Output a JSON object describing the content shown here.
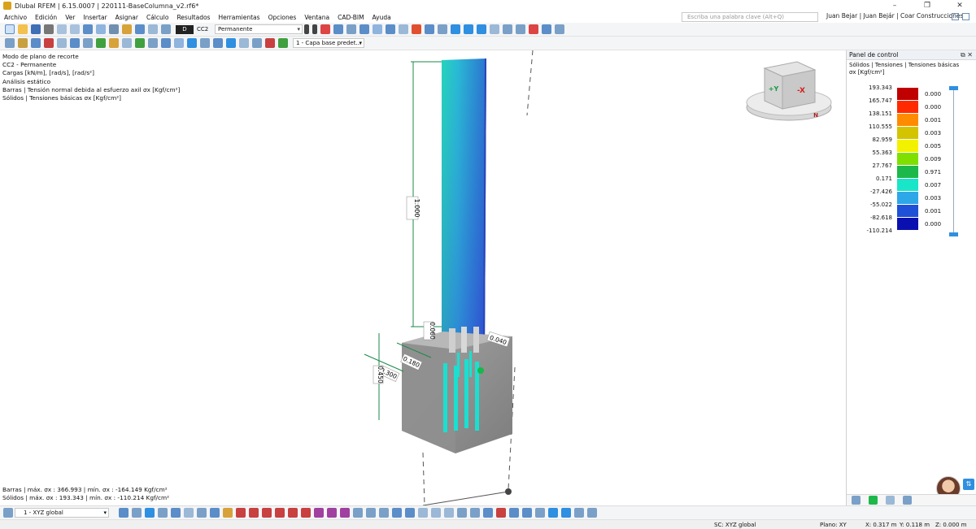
{
  "window": {
    "title": "Dlubal RFEM | 6.15.0007 | 220111-BaseColumna_v2.rf6*",
    "controls": [
      "–",
      "❐",
      "✕"
    ]
  },
  "menu": {
    "items": [
      "Archivo",
      "Edición",
      "Ver",
      "Insertar",
      "Asignar",
      "Cálculo",
      "Resultados",
      "Herramientas",
      "Opciones",
      "Ventana",
      "CAD-BIM",
      "Ayuda"
    ],
    "search_placeholder": "Escriba una palabra clave (Alt+Q)",
    "user": "Juan Bejar | Juan Bejár | Coar Construcciones"
  },
  "toolbar": {
    "load_case_code": "D",
    "load_case_name": "CC2",
    "load_case_select": "Permanente",
    "layer_select": "1 - Capa base predet..."
  },
  "viewport": {
    "info_lines": [
      "Modo de plano de recorte",
      "CC2 - Permanente",
      "Cargas [kN/m], [rad/s], [rad/s²]",
      "Análisis estático",
      "Barras | Tensión normal debida al esfuerzo axil σx [Kgf/cm²]",
      "Sólidos | Tensiones básicas σx [Kgf/cm²]"
    ],
    "summary_lines": [
      "Barras | máx. σx : 366.993 | mín. σx : -164.149 Kgf/cm²",
      "Sólidos | máx. σx : 193.343 | mín. σx : -110.214 Kgf/cm²"
    ],
    "dimensions": {
      "column_height": "1.000",
      "d1": "0.060",
      "d2": "0.040",
      "d3": "0.180",
      "d4": "0.300",
      "d5": "0.450"
    },
    "navcube": {
      "plus_y": "+Y",
      "minus_x": "-X",
      "north": "N"
    }
  },
  "panel": {
    "title": "Panel de control",
    "subtitle": "Sólidos | Tensiones | Tensiones básicas",
    "unit": "σx [Kgf/cm²]",
    "legend": [
      {
        "value": "193.343",
        "color": "#c00000",
        "percent": "0.000"
      },
      {
        "value": "165.747",
        "color": "#ff2a00",
        "percent": "0.000"
      },
      {
        "value": "138.151",
        "color": "#ff8c00",
        "percent": "0.001"
      },
      {
        "value": "110.555",
        "color": "#d4c400",
        "percent": "0.003"
      },
      {
        "value": "82.959",
        "color": "#f2f200",
        "percent": "0.005"
      },
      {
        "value": "55.363",
        "color": "#7fe000",
        "percent": "0.009"
      },
      {
        "value": "27.767",
        "color": "#1db84a",
        "percent": "0.971"
      },
      {
        "value": "0.171",
        "color": "#19e6c8",
        "percent": "0.007"
      },
      {
        "value": "-27.426",
        "color": "#2ea7e8",
        "percent": "0.003"
      },
      {
        "value": "-55.022",
        "color": "#1e50d8",
        "percent": "0.001"
      },
      {
        "value": "-82.618",
        "color": "#0a10b0",
        "percent": "0.000"
      }
    ],
    "min_value": "-110.214"
  },
  "bottom": {
    "coordinate_system": "1 - XYZ global"
  },
  "status": {
    "sc": "SC: XYZ global",
    "plane": "Plano: XY",
    "x": "X: 0.317 m",
    "y": "Y: 0.118 m",
    "z": "Z: 0.000 m"
  }
}
